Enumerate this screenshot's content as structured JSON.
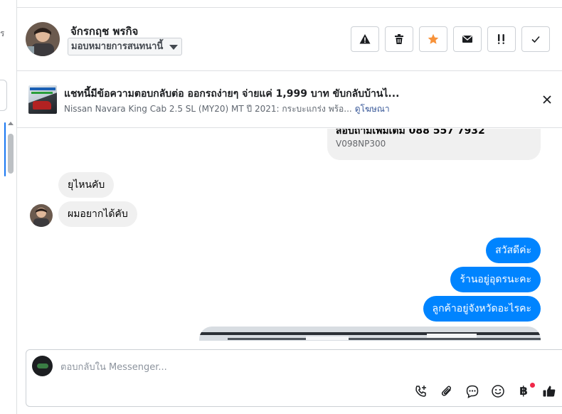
{
  "left_panel": {
    "fragment": "ร"
  },
  "header": {
    "name": "จักรกฤช พรกิจ",
    "assign_label": "มอบหมายการสนทนานี้",
    "actions": [
      {
        "icon": "warning-icon",
        "name": "spam-button"
      },
      {
        "icon": "trash-icon",
        "name": "delete-button"
      },
      {
        "icon": "star-icon",
        "name": "star-button"
      },
      {
        "icon": "envelope-icon",
        "name": "mark-unread-button"
      },
      {
        "icon": "follow-up-icon",
        "name": "follow-up-button"
      },
      {
        "icon": "check-icon",
        "name": "mark-done-button"
      }
    ],
    "accent": "#f7923a"
  },
  "ad": {
    "title": "แชทนี้มีข้อความตอบกลับต่อ ออกรถง่ายๆ จ่ายแค่ 1,999 บาท ขับกลับบ้านไ...",
    "subtitle": "Nissan Navara King Cab 2.5 SL (MY20) MT ปี 2021: กระบะแกร่ง พร้อ...",
    "link": "ดูโฆษณา"
  },
  "messages": {
    "prev_line1": "สอบถามเพิ่มเติม 088 557 7932",
    "prev_line2": "V098NP300",
    "incoming": [
      "ยุไหนคับ",
      "ผมอยากได้คับ"
    ],
    "outgoing": [
      "สวัสดีค่ะ",
      "ร้านอยู่อุดรนะคะ",
      "ลูกค้าอยู่จังหวัดอะไรคะ"
    ],
    "outgoing_color": "#0084ff"
  },
  "composer": {
    "placeholder": "ตอบกลับใน Messenger...",
    "tools": [
      "call-add-icon",
      "paperclip-icon",
      "saved-reply-icon",
      "emoji-icon",
      "baht-icon",
      "thumbs-up-icon"
    ],
    "baht_symbol": "฿"
  }
}
